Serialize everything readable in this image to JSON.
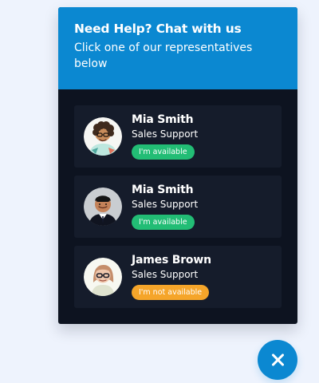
{
  "chat_widget": {
    "title": "Need Help? Chat with us",
    "subtitle": "Click one of our representatives below",
    "header_color": "#0b88d1",
    "body_color": "#0d1320",
    "card_color": "#151c2b"
  },
  "representatives": [
    {
      "name": "Mia Smith",
      "role": "Sales Support",
      "status": "I'm available",
      "status_type": "available",
      "avatar_icon": "avatar-curly-hair-man"
    },
    {
      "name": "Mia Smith",
      "role": "Sales Support",
      "status": "I'm available",
      "status_type": "available",
      "avatar_icon": "avatar-man-suit"
    },
    {
      "name": "James Brown",
      "role": "Sales Support",
      "status": "I'm not available",
      "status_type": "unavailable",
      "avatar_icon": "avatar-woman-glasses"
    }
  ],
  "close_button": {
    "icon": "close-icon",
    "color": "#0b88d1"
  },
  "status_colors": {
    "available": "#22bd75",
    "unavailable": "#f5a52a"
  }
}
